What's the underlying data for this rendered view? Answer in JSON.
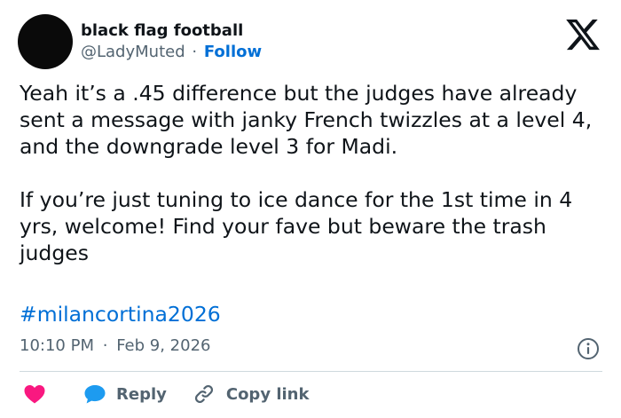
{
  "author": {
    "name": "black flag football",
    "handle": "@LadyMuted",
    "separator": "·",
    "follow_label": "Follow"
  },
  "post": {
    "text": "Yeah it’s a .45 difference but the judges have already sent a message with janky French twizzles at a level 4, and the downgrade level 3 for Madi.\n\nIf you’re just tuning to ice dance for the 1st time in 4 yrs, welcome! Find your fave but beware the trash judges",
    "hashtag": "#milancortina2026",
    "time": "10:10 PM",
    "separator": "·",
    "date": "Feb 9, 2026"
  },
  "actions": {
    "reply_label": "Reply",
    "copy_label": "Copy link"
  },
  "icons": {
    "brand": "x-logo-icon",
    "info": "info-icon",
    "like": "heart-icon",
    "reply": "speech-bubble-icon",
    "copy": "link-icon"
  },
  "colors": {
    "link": "#006fd6",
    "heart": "#f91880",
    "reply_bubble": "#1d9bf0",
    "secondary_text": "#536471",
    "divider": "#cfd9de"
  }
}
